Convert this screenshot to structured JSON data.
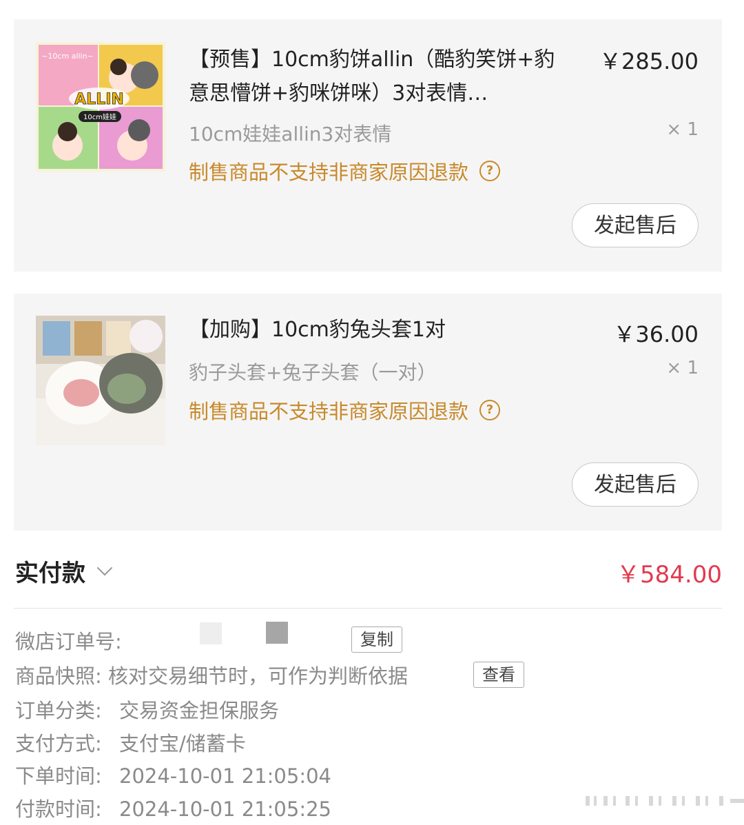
{
  "items": [
    {
      "title": "【预售】10cm豹饼allin（酷豹笑饼+豹意思懵饼+豹咪饼咪）3对表情…",
      "price": "￥285.00",
      "spec": "10cm娃娃allin3对表情",
      "qty": "× 1",
      "notice": "制售商品不支持非商家原因退款",
      "after_sale": "发起售后",
      "thumb_text": {
        "banner": "~10cm allin~",
        "logo": "ALLIN",
        "sub": "10cm娃娃"
      }
    },
    {
      "title": "【加购】10cm豹兔头套1对",
      "price": "￥36.00",
      "spec": "豹子头套+兔子头套（一对）",
      "qty": "× 1",
      "notice": "制售商品不支持非商家原因退款",
      "after_sale": "发起售后"
    }
  ],
  "summary": {
    "label": "实付款",
    "amount": "￥584.00"
  },
  "info": {
    "order_no_label": "微店订单号:",
    "copy_button": "复制",
    "snapshot_label": "商品快照:",
    "snapshot_value": "核对交易细节时，可作为判断依据",
    "view_button": "查看",
    "category_label": "订单分类:",
    "category_value": "交易资金担保服务",
    "payment_label": "支付方式:",
    "payment_value": "支付宝/储蓄卡",
    "order_time_label": "下单时间:",
    "order_time_value": "2024-10-01 21:05:04",
    "pay_time_label": "付款时间:",
    "pay_time_value": "2024-10-01 21:05:25"
  },
  "colors": {
    "accent_price": "#e23a4e",
    "notice": "#c8892a",
    "card_bg": "#f5f5f5"
  },
  "icons": [
    "help-circle-icon",
    "chevron-down-icon"
  ]
}
